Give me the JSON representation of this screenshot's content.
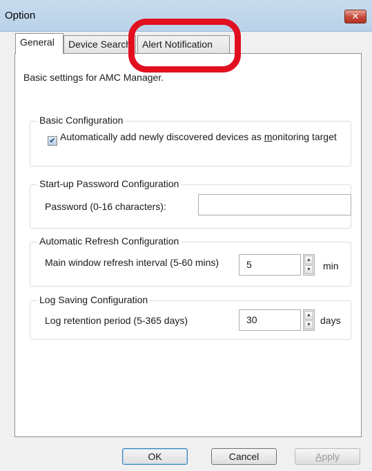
{
  "window": {
    "title": "Option",
    "close_glyph": "✕"
  },
  "tabs": [
    {
      "label": "General",
      "active": true
    },
    {
      "label": "Device Search",
      "active": false
    },
    {
      "label": "Alert Notification",
      "active": false
    }
  ],
  "general": {
    "intro": "Basic settings for AMC Manager.",
    "basic_config": {
      "legend": "Basic Configuration",
      "checkbox_text_before": "Automatically add newly discovered devices as ",
      "checkbox_text_mnemonic": "m",
      "checkbox_text_after": "onitoring target",
      "checked": true
    },
    "startup_password": {
      "legend": "Start-up Password Configuration",
      "label": "Password (0-16 characters):",
      "value": ""
    },
    "auto_refresh": {
      "legend": "Automatic Refresh Configuration",
      "label": "Main window refresh interval (5-60 mins)",
      "value": "5",
      "unit": "min"
    },
    "log_saving": {
      "legend": "Log Saving Configuration",
      "label": "Log retention period (5-365 days)",
      "value": "30",
      "unit": "days"
    }
  },
  "buttons": {
    "ok": "OK",
    "cancel": "Cancel",
    "apply_mnemonic": "A",
    "apply_rest": "pply"
  },
  "annotation": {
    "color": "#e10f1f",
    "target": "Alert Notification tab"
  }
}
